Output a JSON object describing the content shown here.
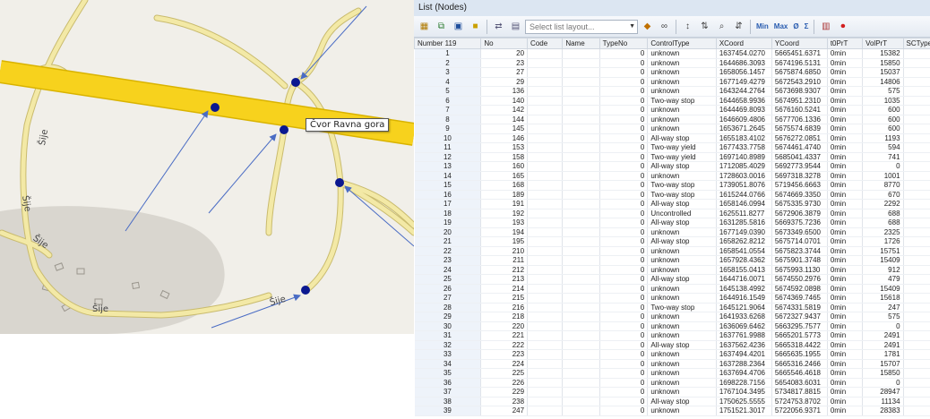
{
  "map": {
    "node_label": "Čvor Ravna gora",
    "place_labels": [
      "Šije",
      "Šije",
      "Šije",
      "Šije"
    ]
  },
  "list": {
    "title": "List (Nodes)",
    "layout_placeholder": "Select list layout...",
    "toolbar_text": [
      "Min",
      "Max",
      "Ø",
      "Σ"
    ],
    "columns": [
      "Number 119",
      "No",
      "Code",
      "Name",
      "TypeNo",
      "ControlType",
      "XCoord",
      "YCoord",
      "t0PrT",
      "VolPrT",
      "SCType"
    ],
    "rows": [
      [
        1,
        20,
        "",
        "",
        0,
        "unknown",
        "1637454.0270",
        "5665451.6371",
        "0min",
        15382,
        ""
      ],
      [
        2,
        23,
        "",
        "",
        0,
        "unknown",
        "1644686.3093",
        "5674196.5131",
        "0min",
        15850,
        ""
      ],
      [
        3,
        27,
        "",
        "",
        0,
        "unknown",
        "1658056.1457",
        "5675874.6850",
        "0min",
        15037,
        ""
      ],
      [
        4,
        29,
        "",
        "",
        0,
        "unknown",
        "1677149.4279",
        "5672543.2910",
        "0min",
        14806,
        ""
      ],
      [
        5,
        136,
        "",
        "",
        0,
        "unknown",
        "1643244.2764",
        "5673698.9307",
        "0min",
        575,
        ""
      ],
      [
        6,
        140,
        "",
        "",
        0,
        "Two-way stop",
        "1644658.9936",
        "5674951.2310",
        "0min",
        1035,
        ""
      ],
      [
        7,
        142,
        "",
        "",
        0,
        "unknown",
        "1644469.8093",
        "5676160.5241",
        "0min",
        600,
        ""
      ],
      [
        8,
        144,
        "",
        "",
        0,
        "unknown",
        "1646609.4806",
        "5677706.1336",
        "0min",
        600,
        ""
      ],
      [
        9,
        145,
        "",
        "",
        0,
        "unknown",
        "1653671.2645",
        "5675574.6839",
        "0min",
        600,
        ""
      ],
      [
        10,
        146,
        "",
        "",
        0,
        "All-way stop",
        "1655183.4102",
        "5676272.0851",
        "0min",
        1193,
        ""
      ],
      [
        11,
        153,
        "",
        "",
        0,
        "Two-way yield",
        "1677433.7758",
        "5674461.4740",
        "0min",
        594,
        ""
      ],
      [
        12,
        158,
        "",
        "",
        0,
        "Two-way yield",
        "1697140.8989",
        "5685041.4337",
        "0min",
        741,
        ""
      ],
      [
        13,
        160,
        "",
        "",
        0,
        "All-way stop",
        "1712085.4029",
        "5692773.9544",
        "0min",
        0,
        ""
      ],
      [
        14,
        165,
        "",
        "",
        0,
        "unknown",
        "1728603.0016",
        "5697318.3278",
        "0min",
        1001,
        ""
      ],
      [
        15,
        168,
        "",
        "",
        0,
        "Two-way stop",
        "1739051.8076",
        "5719456.6663",
        "0min",
        8770,
        ""
      ],
      [
        16,
        189,
        "",
        "",
        0,
        "Two-way stop",
        "1615244.0766",
        "5674669.3350",
        "0min",
        670,
        ""
      ],
      [
        17,
        191,
        "",
        "",
        0,
        "All-way stop",
        "1658146.0994",
        "5675335.9730",
        "0min",
        2292,
        ""
      ],
      [
        18,
        192,
        "",
        "",
        0,
        "Uncontrolled",
        "1625511.8277",
        "5672906.3879",
        "0min",
        688,
        ""
      ],
      [
        19,
        193,
        "",
        "",
        0,
        "All-way stop",
        "1631285.5816",
        "5669375.7236",
        "0min",
        688,
        ""
      ],
      [
        20,
        194,
        "",
        "",
        0,
        "unknown",
        "1677149.0390",
        "5673349.6500",
        "0min",
        2325,
        ""
      ],
      [
        21,
        195,
        "",
        "",
        0,
        "All-way stop",
        "1658262.8212",
        "5675714.0701",
        "0min",
        1726,
        ""
      ],
      [
        22,
        210,
        "",
        "",
        0,
        "unknown",
        "1658541.0554",
        "5675823.3744",
        "0min",
        15751,
        ""
      ],
      [
        23,
        211,
        "",
        "",
        0,
        "unknown",
        "1657928.4362",
        "5675901.3748",
        "0min",
        15409,
        ""
      ],
      [
        24,
        212,
        "",
        "",
        0,
        "unknown",
        "1658155.0413",
        "5675993.1130",
        "0min",
        912,
        ""
      ],
      [
        25,
        213,
        "",
        "",
        0,
        "All-way stop",
        "1644716.0071",
        "5674550.2976",
        "0min",
        479,
        ""
      ],
      [
        26,
        214,
        "",
        "",
        0,
        "unknown",
        "1645138.4992",
        "5674592.0898",
        "0min",
        15409,
        ""
      ],
      [
        27,
        215,
        "",
        "",
        0,
        "unknown",
        "1644916.1549",
        "5674369.7465",
        "0min",
        15618,
        ""
      ],
      [
        28,
        216,
        "",
        "",
        0,
        "Two-way stop",
        "1645121.9064",
        "5674331.5819",
        "0min",
        247,
        ""
      ],
      [
        29,
        218,
        "",
        "",
        0,
        "unknown",
        "1641933.6268",
        "5672327.9437",
        "0min",
        575,
        ""
      ],
      [
        30,
        220,
        "",
        "",
        0,
        "unknown",
        "1636069.6462",
        "5663295.7577",
        "0min",
        0,
        ""
      ],
      [
        31,
        221,
        "",
        "",
        0,
        "unknown",
        "1637761.9988",
        "5665201.5773",
        "0min",
        2491,
        ""
      ],
      [
        32,
        222,
        "",
        "",
        0,
        "All-way stop",
        "1637562.4236",
        "5665318.4422",
        "0min",
        2491,
        ""
      ],
      [
        33,
        223,
        "",
        "",
        0,
        "unknown",
        "1637494.4201",
        "5665635.1955",
        "0min",
        1781,
        ""
      ],
      [
        34,
        224,
        "",
        "",
        0,
        "unknown",
        "1637288.2364",
        "5665316.2466",
        "0min",
        15707,
        ""
      ],
      [
        35,
        225,
        "",
        "",
        0,
        "unknown",
        "1637694.4706",
        "5665546.4618",
        "0min",
        15850,
        ""
      ],
      [
        36,
        226,
        "",
        "",
        0,
        "unknown",
        "1698228.7156",
        "5654083.6031",
        "0min",
        0,
        ""
      ],
      [
        37,
        229,
        "",
        "",
        0,
        "unknown",
        "1767104.3495",
        "5734817.8815",
        "0min",
        28947,
        ""
      ],
      [
        38,
        238,
        "",
        "",
        0,
        "All-way stop",
        "1750625.5555",
        "5724753.8702",
        "0min",
        11134,
        ""
      ],
      [
        39,
        247,
        "",
        "",
        0,
        "unknown",
        "1751521.3017",
        "5722056.9371",
        "0min",
        28383,
        ""
      ]
    ]
  },
  "colors": {
    "motorway": "#f7d21d",
    "motorway_edge": "#d9b300",
    "road": "#f3e9a6",
    "road_edge": "#c9bb6e",
    "node": "#0b1890",
    "arrow": "#4a6cc4",
    "map_bg": "#f1efe9",
    "settlement": "#d9d6cf",
    "header_bg": "#dce6f2"
  },
  "icons": [
    "table-icon",
    "copy-icon",
    "save-icon",
    "filter-icon",
    "sync-icon",
    "chart-icon",
    "marker-icon",
    "binoculars-icon",
    "sort-asc-icon",
    "sort-desc-icon",
    "zoom-icon",
    "record-icon"
  ]
}
